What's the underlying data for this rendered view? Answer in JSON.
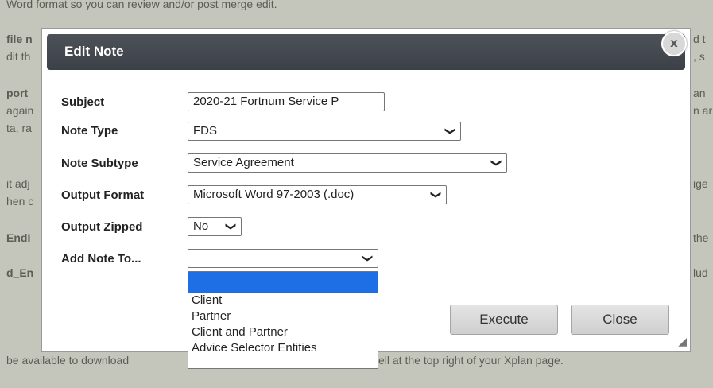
{
  "background": {
    "lines": [
      "Word format so you can review and/or post merge edit.",
      "file n",
      "dit th",
      "port",
      "again",
      "ta, ra",
      "it adj",
      "hen c",
      "EndI",
      "d_En",
      "d t",
      ", s",
      "an",
      "n ar",
      "ige",
      "the",
      "lud",
      "be available to download",
      "ell at the top right of your Xplan page."
    ]
  },
  "dialog": {
    "title": "Edit Note",
    "close_glyph": "x",
    "fields": {
      "subject": {
        "label": "Subject",
        "value": "2020-21 Fortnum Service P"
      },
      "note_type": {
        "label": "Note Type",
        "value": "FDS"
      },
      "note_subtype": {
        "label": "Note Subtype",
        "value": "Service Agreement"
      },
      "output_format": {
        "label": "Output Format",
        "value": "Microsoft Word 97-2003 (.doc)"
      },
      "output_zipped": {
        "label": "Output Zipped",
        "value": "No"
      },
      "add_note_to": {
        "label": "Add Note To...",
        "value": ""
      }
    },
    "chevron": "❯",
    "add_note_options": [
      "",
      "Client",
      "Partner",
      "Client and Partner",
      "Advice Selector Entities"
    ],
    "buttons": {
      "execute": "Execute",
      "close": "Close"
    },
    "resize_glyph": "◢"
  },
  "colors": {
    "title_bar": "#45494f",
    "selected_option": "#1e6ee6",
    "overlay": "#c4c6bc"
  }
}
